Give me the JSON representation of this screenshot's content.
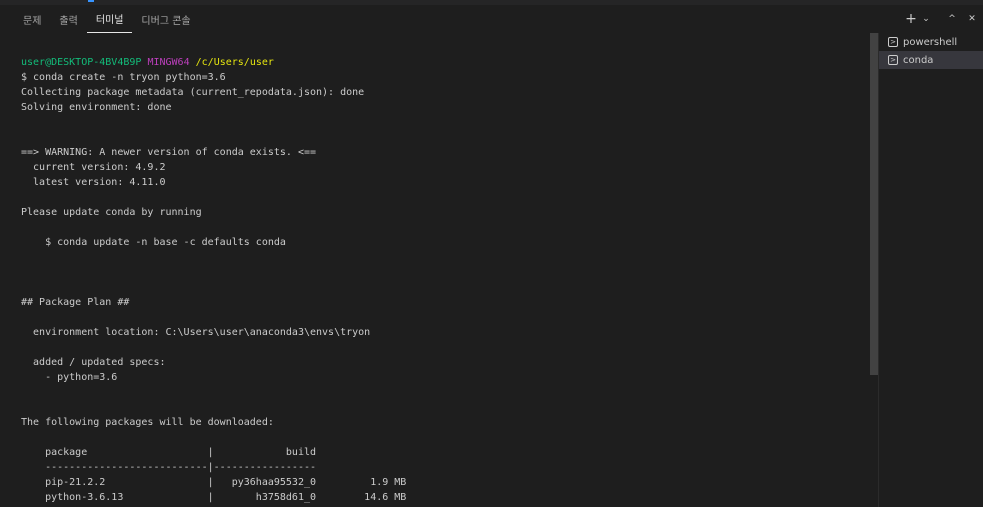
{
  "panel": {
    "tabs": [
      {
        "label": "문제"
      },
      {
        "label": "출력"
      },
      {
        "label": "터미널"
      },
      {
        "label": "디버그 콘솔"
      }
    ],
    "active_tab": "터미널",
    "actions": {
      "new_terminal": "+",
      "dropdown": "⌄",
      "maximize": "^",
      "close": "✕"
    }
  },
  "terminal": {
    "prompt": {
      "user_host": "user@DESKTOP-4BV4B9P",
      "shell": "MINGW64",
      "path": "/c/Users/user"
    },
    "lines": [
      "$ conda create -n tryon python=3.6",
      "Collecting package metadata (current_repodata.json): done",
      "Solving environment: done",
      "",
      "",
      "==> WARNING: A newer version of conda exists. <==",
      "  current version: 4.9.2",
      "  latest version: 4.11.0",
      "",
      "Please update conda by running",
      "",
      "    $ conda update -n base -c defaults conda",
      "",
      "",
      "",
      "## Package Plan ##",
      "",
      "  environment location: C:\\Users\\user\\anaconda3\\envs\\tryon",
      "",
      "  added / updated specs:",
      "    - python=3.6",
      "",
      "",
      "The following packages will be downloaded:",
      "",
      "    package                    |            build",
      "    ---------------------------|-----------------",
      "    pip-21.2.2                 |   py36haa95532_0         1.9 MB",
      "    python-3.6.13              |       h3758d61_0        14.6 MB",
      "                               |"
    ]
  },
  "terminal_list": {
    "items": [
      {
        "label": "powershell",
        "icon": "terminal-icon",
        "selected": false
      },
      {
        "label": "conda",
        "icon": "terminal-icon",
        "selected": true
      }
    ]
  },
  "colors": {
    "background": "#1e1e1e",
    "prompt_user": "#13bc7a",
    "prompt_shell": "#bc3fbc",
    "prompt_path": "#e5e510"
  }
}
